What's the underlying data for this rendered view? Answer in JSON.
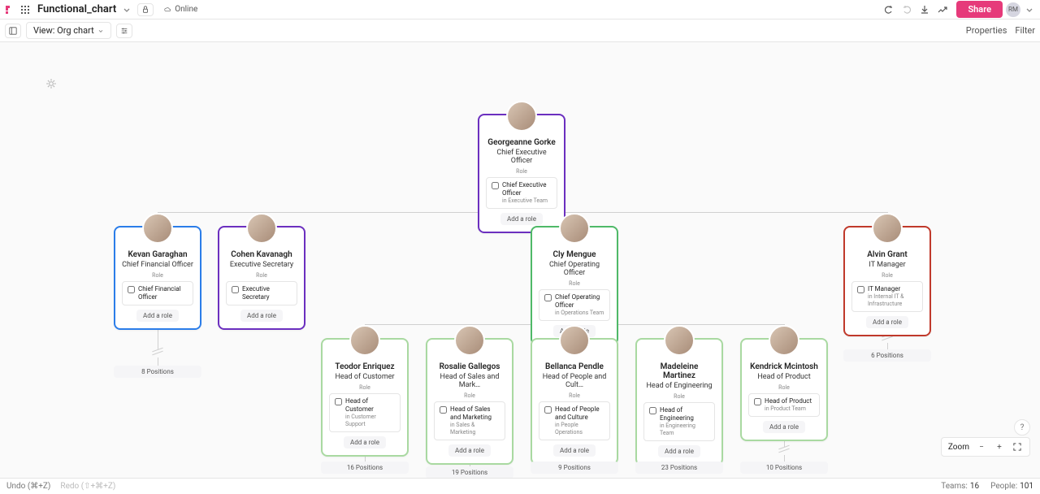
{
  "header": {
    "doc_title": "Functional_chart",
    "status": "Online",
    "share": "Share",
    "user_initials": "RM"
  },
  "toolbar": {
    "view_label": "View: Org chart",
    "properties": "Properties",
    "filter": "Filter"
  },
  "labels": {
    "role": "Role",
    "add_role": "Add a role",
    "zoom": "Zoom"
  },
  "footer": {
    "undo": "Undo (⌘+Z)",
    "redo": "Redo (⇧+⌘+Z)",
    "teams_label": "Teams:",
    "teams_count": "16",
    "people_label": "People:",
    "people_count": "101"
  },
  "cards": {
    "ceo": {
      "name": "Georgeanne Gorke",
      "title": "Chief Executive Officer",
      "role_title": "Chief Executive Officer",
      "role_team": "in Executive Team"
    },
    "cfo": {
      "name": "Kevan Garaghan",
      "title": "Chief Financial Officer",
      "role_title": "Chief Financial Officer",
      "role_team": "",
      "positions": "8 Positions"
    },
    "sec": {
      "name": "Cohen Kavanagh",
      "title": "Executive Secretary",
      "role_title": "Executive Secretary",
      "role_team": ""
    },
    "coo": {
      "name": "Cly Mengue",
      "title": "Chief Operating Officer",
      "role_title": "Chief Operating Officer",
      "role_team": "in Operations Team"
    },
    "it": {
      "name": "Alvin Grant",
      "title": "IT Manager",
      "role_title": "IT Manager",
      "role_team": "in Internal IT & Infrastructure",
      "positions": "6 Positions"
    },
    "cust": {
      "name": "Teodor Enriquez",
      "title": "Head of Customer",
      "role_title": "Head of Customer",
      "role_team": "in Customer Support",
      "positions": "16 Positions"
    },
    "sales": {
      "name": "Rosalie Gallegos",
      "title": "Head of Sales and Mark…",
      "role_title": "Head of Sales and Marketing",
      "role_team": "in Sales & Marketing",
      "positions": "19 Positions"
    },
    "people": {
      "name": "Bellanca Pendle",
      "title": "Head of People and Cult…",
      "role_title": "Head of People and Culture",
      "role_team": "in People Operations",
      "positions": "9 Positions"
    },
    "eng": {
      "name": "Madeleine Martinez",
      "title": "Head of Engineering",
      "role_title": "Head of Engineering",
      "role_team": "in Engineering Team",
      "positions": "23 Positions"
    },
    "prod": {
      "name": "Kendrick Mcintosh",
      "title": "Head of Product",
      "role_title": "Head of Product",
      "role_team": "in Product Team",
      "positions": "10 Positions"
    }
  }
}
